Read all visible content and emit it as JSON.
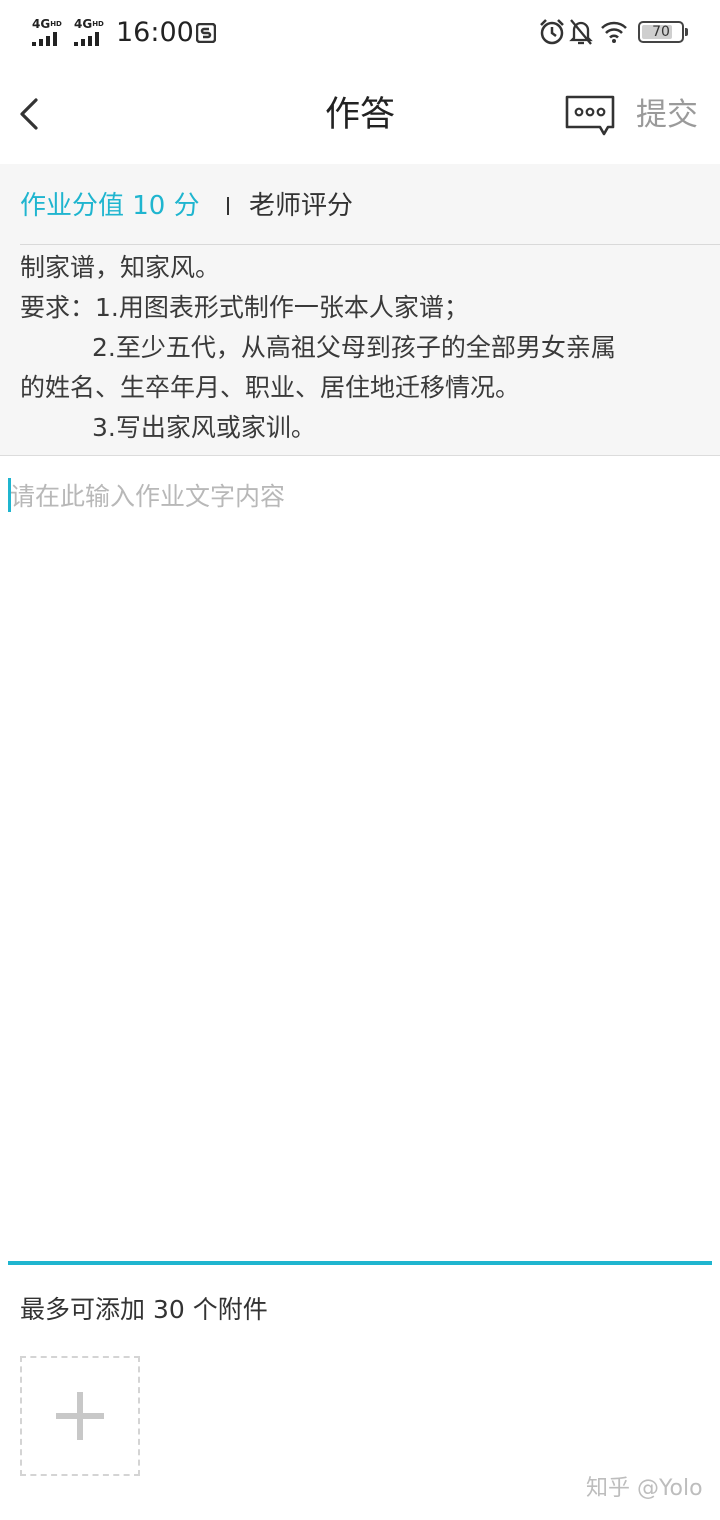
{
  "status_bar": {
    "network_1": "4G",
    "network_1_sup": "HD",
    "network_2": "4G",
    "network_2_sup": "HD",
    "time": "16:00",
    "battery": "70",
    "icons": [
      "screenshot-icon",
      "alarm-icon",
      "bell-off-icon",
      "wifi-icon",
      "battery-icon"
    ]
  },
  "nav": {
    "title": "作答",
    "submit_label": "提交",
    "icons": [
      "back-arrow-icon",
      "chat-bubble-icon"
    ]
  },
  "info": {
    "score_label": "作业分值 10 分",
    "teacher_label": "老师评分",
    "description_lines": [
      "制家谱，知家风。",
      "要求：1.用图表形式制作一张本人家谱；",
      "2.至少五代，从高祖父母到孩子的全部男女亲属",
      "的姓名、生卒年月、职业、居住地迁移情况。",
      "3.写出家风或家训。"
    ]
  },
  "answer": {
    "placeholder": "请在此输入作业文字内容",
    "value": ""
  },
  "attachments": {
    "label": "最多可添加 30 个附件",
    "add_icon": "plus-icon"
  },
  "watermark": "知乎 @Yolo",
  "colors": {
    "accent": "#1fb5cf",
    "text": "#333333",
    "muted": "#9a9a9a",
    "section_bg": "#f6f6f6"
  }
}
